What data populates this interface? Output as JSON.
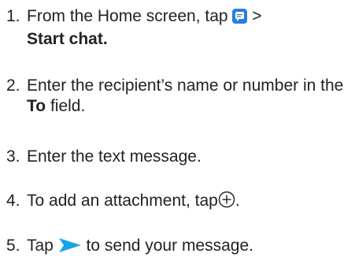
{
  "steps": [
    {
      "number": "1.",
      "text_before": "From the Home screen, tap ",
      "icon": "messages-app-icon",
      "separator": " >",
      "bold": "Start chat."
    },
    {
      "number": "2.",
      "text_before": "Enter the recipient’s name or number in the ",
      "bold": "To",
      "text_after": " field."
    },
    {
      "number": "3.",
      "text": "Enter the text message."
    },
    {
      "number": "4.",
      "text_before": "To add an attachment, tap",
      "icon": "plus-circle-icon",
      "text_after": "."
    },
    {
      "number": "5.",
      "text_before": "Tap ",
      "icon": "send-arrow-icon",
      "text_after": " to send your message."
    }
  ],
  "colors": {
    "text": "#222222",
    "messages_icon": "#2a7de1",
    "send_icon": "#1aa3e8"
  }
}
